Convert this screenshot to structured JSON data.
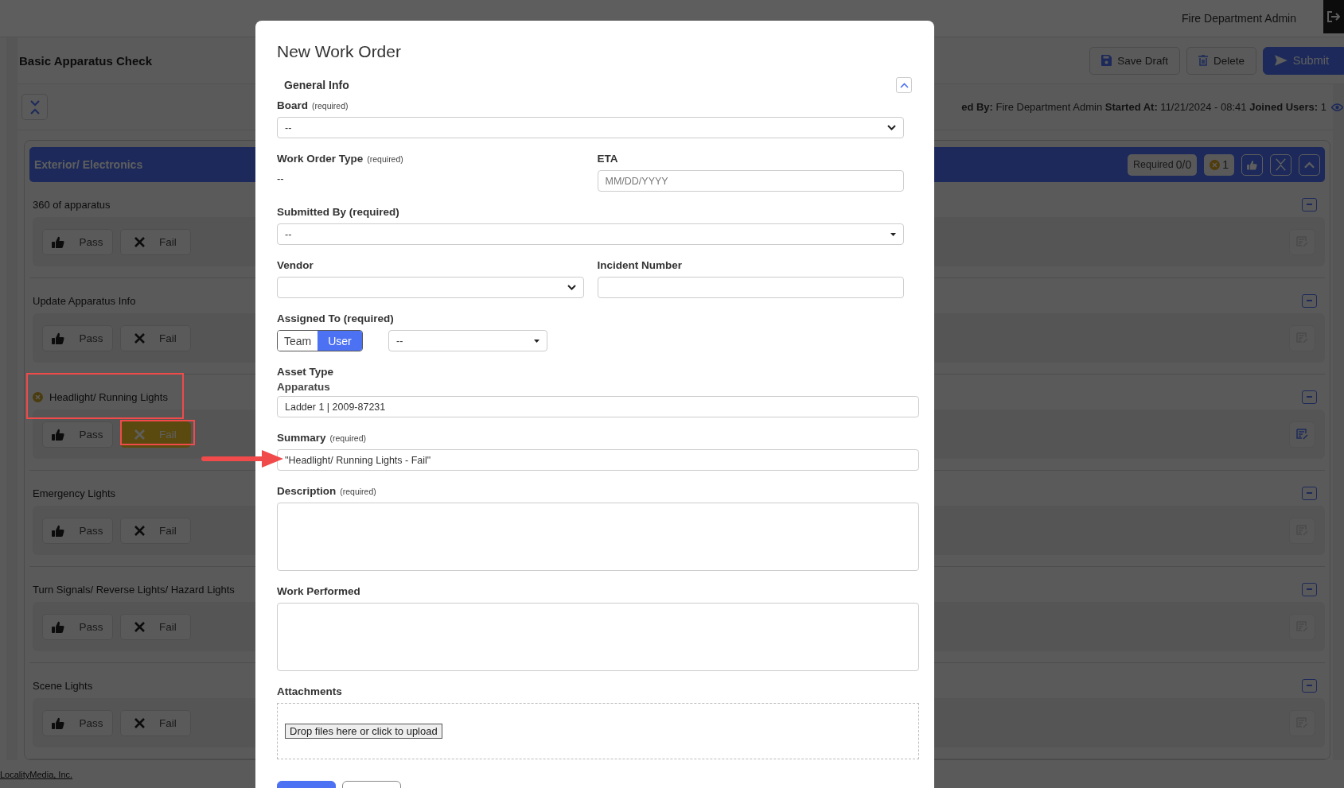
{
  "top_bar": {
    "user": "Fire Department Admin"
  },
  "page": {
    "title": "Basic Apparatus Check",
    "actions": [
      {
        "label": "Save Draft",
        "kind": "save"
      },
      {
        "label": "Delete",
        "kind": "delete"
      },
      {
        "label": "Submit",
        "kind": "submit"
      }
    ],
    "info": "**ed By:** Fire Department Admin **Started At:** 11/21/2024 - 08:41 **Joined Users:** 1"
  },
  "section": {
    "title": "Exterior/ Electronics",
    "required_label": "Required",
    "required_count": "0/0",
    "fail_count": "1",
    "expanded": true,
    "items": [
      {
        "label": "360 of apparatus",
        "note_active": false,
        "buttons": [
          {
            "label": "Pass",
            "kind": "pass",
            "selected": false
          },
          {
            "label": "Fail",
            "kind": "fail",
            "selected": false
          }
        ]
      },
      {
        "label": "Update Apparatus Info",
        "note_active": false,
        "buttons": [
          {
            "label": "Pass",
            "kind": "pass",
            "selected": false
          },
          {
            "label": "Fail",
            "kind": "fail",
            "selected": false
          }
        ]
      },
      {
        "label": "Headlight/ Running Lights",
        "note_active": true,
        "buttons": [
          {
            "label": "Pass",
            "kind": "pass",
            "selected": false
          },
          {
            "label": "Fail",
            "kind": "fail",
            "selected": true
          }
        ]
      },
      {
        "label": "Emergency Lights",
        "note_active": false,
        "buttons": [
          {
            "label": "Pass",
            "kind": "pass",
            "selected": false
          },
          {
            "label": "Fail",
            "kind": "fail",
            "selected": false
          }
        ]
      },
      {
        "label": "Turn Signals/ Reverse Lights/ Hazard Lights",
        "note_active": false,
        "buttons": [
          {
            "label": "Pass",
            "kind": "pass",
            "selected": false
          },
          {
            "label": "Fail",
            "kind": "fail",
            "selected": false
          }
        ]
      },
      {
        "label": "Scene Lights",
        "note_active": false,
        "buttons": [
          {
            "label": "Pass",
            "kind": "pass",
            "selected": false
          },
          {
            "label": "Fail",
            "kind": "fail",
            "selected": false
          }
        ]
      }
    ]
  },
  "footer": {
    "link": "LocalityMedia, Inc."
  },
  "modal": {
    "title": "New Work Order",
    "general_info": {
      "title": "General Info",
      "expanded": true,
      "rows": [
        [
          {
            "kind": "select",
            "label": "Board",
            "note": "(required)",
            "value": "--"
          }
        ],
        [
          {
            "kind": "static",
            "label": "Work Order Type",
            "note": "(required)",
            "value": "--"
          },
          {
            "kind": "date",
            "label": "ETA",
            "placeholder": "MM/DD/YYYY"
          }
        ],
        [
          {
            "kind": "combo",
            "label": "Submitted By (required)",
            "value": "--"
          }
        ],
        [
          {
            "kind": "select",
            "label": "Vendor"
          },
          {
            "kind": "text",
            "label": "Incident Number"
          }
        ],
        [
          {
            "kind": "assign",
            "label": "Assigned To (required)",
            "options": [
              {
                "label": "Team",
                "selected": false
              },
              {
                "label": "User",
                "selected": true
              }
            ],
            "value": "--"
          }
        ],
        [
          {
            "kind": "heading",
            "label": "Asset Type"
          }
        ],
        [
          {
            "kind": "subheading",
            "label": "Apparatus"
          }
        ]
      ]
    },
    "fields": [
      {
        "kind": "text",
        "value": "Ladder 1 | 2009-87231"
      },
      {
        "kind": "text",
        "label": "Summary",
        "note": "(required)",
        "value": "\"Headlight/ Running Lights - Fail\""
      },
      {
        "kind": "textarea",
        "label": "Description",
        "note": "(required)"
      },
      {
        "kind": "textarea",
        "label": "Work Performed"
      },
      {
        "kind": "dropzone",
        "label": "Attachments",
        "button": "Drop files here or click to upload"
      }
    ],
    "buttons": [
      {
        "kind": "primary"
      },
      {
        "kind": "secondary"
      }
    ]
  }
}
